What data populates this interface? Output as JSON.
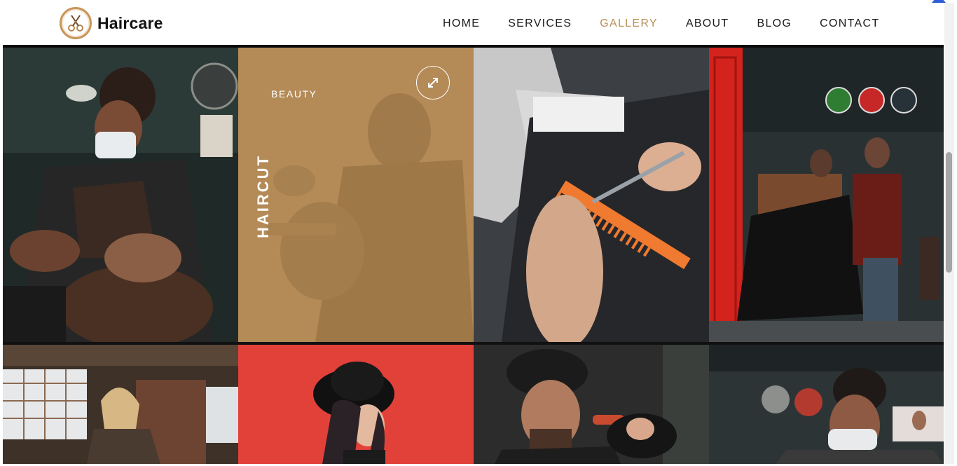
{
  "brand": {
    "name": "Haircare",
    "accent": "#b98f54"
  },
  "nav": [
    {
      "label": "HOME"
    },
    {
      "label": "SERVICES"
    },
    {
      "label": "GALLERY",
      "active": true
    },
    {
      "label": "ABOUT"
    },
    {
      "label": "BLOG"
    },
    {
      "label": "CONTACT"
    }
  ],
  "gallery": {
    "featured": {
      "category": "BEAUTY",
      "title": "HAIRCUT",
      "icon": "expand-icon"
    }
  }
}
